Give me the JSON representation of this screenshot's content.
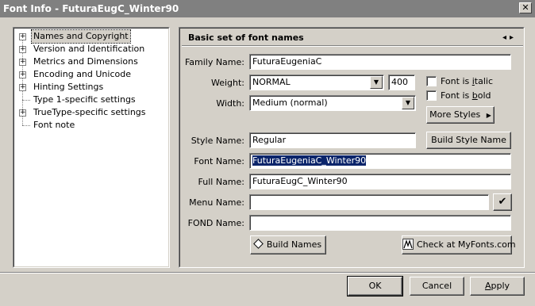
{
  "window": {
    "title": "Font Info - FuturaEugC_Winter90",
    "close_glyph": "✕"
  },
  "tree": {
    "items": [
      {
        "label": "Names and Copyright",
        "expander": "+",
        "selected": true
      },
      {
        "label": "Version and Identification",
        "expander": "+"
      },
      {
        "label": "Metrics and Dimensions",
        "expander": "+"
      },
      {
        "label": "Encoding and Unicode",
        "expander": "+"
      },
      {
        "label": "Hinting Settings",
        "expander": "+"
      },
      {
        "label": "Type 1-specific settings",
        "expander": ""
      },
      {
        "label": "TrueType-specific settings",
        "expander": "+"
      },
      {
        "label": "Font note",
        "expander": ""
      }
    ]
  },
  "panel": {
    "title": "Basic set of font names",
    "nav_prev": "◂",
    "nav_next": "▸",
    "family_label": "Family Name:",
    "family_value": "FuturaEugeniaC",
    "weight_label": "Weight:",
    "weight_value": "NORMAL",
    "weight_number": "400",
    "width_label": "Width:",
    "width_value": "Medium (normal)",
    "italic_label_pre": "Font is ",
    "italic_label_key": "i",
    "italic_label_post": "talic",
    "bold_label_pre": "Font is ",
    "bold_label_key": "b",
    "bold_label_post": "old",
    "more_styles": "More Styles",
    "style_label": "Style Name:",
    "style_value": "Regular",
    "build_style": "Build Style Name",
    "fontname_label": "Font Name:",
    "fontname_value": "FuturaEugeniaC_Winter90",
    "fullname_label": "Full Name:",
    "fullname_value": "FuturaEugC_Winter90",
    "menuname_label": "Menu Name:",
    "menuname_value": "",
    "check_glyph": "✔",
    "fond_label": "FOND Name:",
    "fond_value": "",
    "build_names": "Build Names",
    "check_myfonts": "Check at MyFonts.com"
  },
  "footer": {
    "ok": "OK",
    "cancel": "Cancel",
    "apply_key": "A",
    "apply_rest": "pply"
  },
  "icons": {
    "combo_arrow": "▼",
    "more_arrow": "▶",
    "build_names_icon": "diamond-arrow-icon",
    "myfonts_icon": "myfonts-icon"
  }
}
